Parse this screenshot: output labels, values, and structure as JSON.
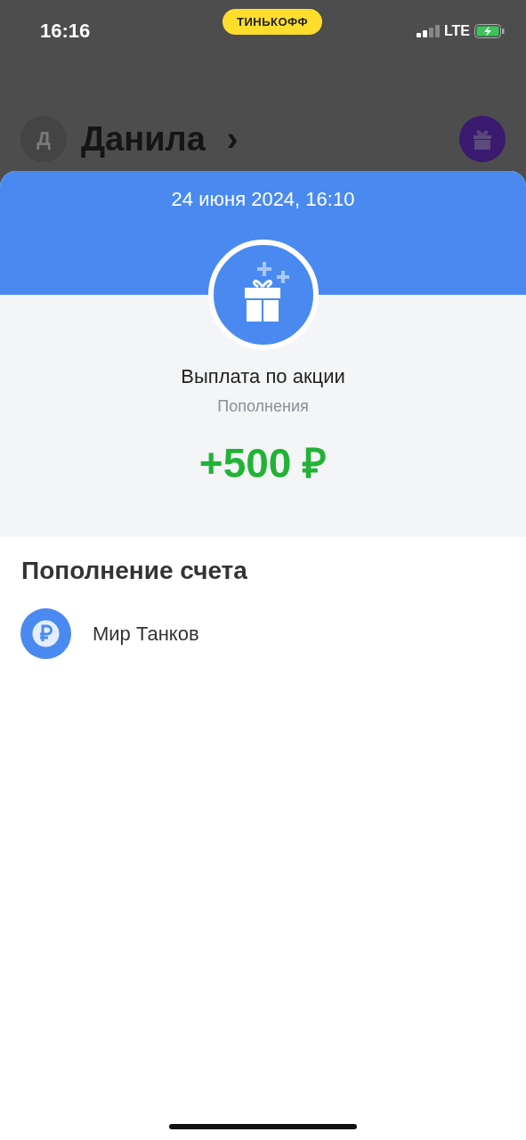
{
  "status_bar": {
    "time": "16:16",
    "carrier_badge": "ТИНЬКОФФ",
    "network": "LTE"
  },
  "profile": {
    "avatar_letter": "Д",
    "name": "Данила",
    "chevron": "›"
  },
  "operation": {
    "date": "24 июня 2024, 16:10",
    "title": "Выплата по акции",
    "category": "Пополнения",
    "amount": "+500 ₽"
  },
  "details": {
    "heading": "Пополнение счета",
    "items": [
      {
        "label": "Мир Танков"
      }
    ]
  }
}
